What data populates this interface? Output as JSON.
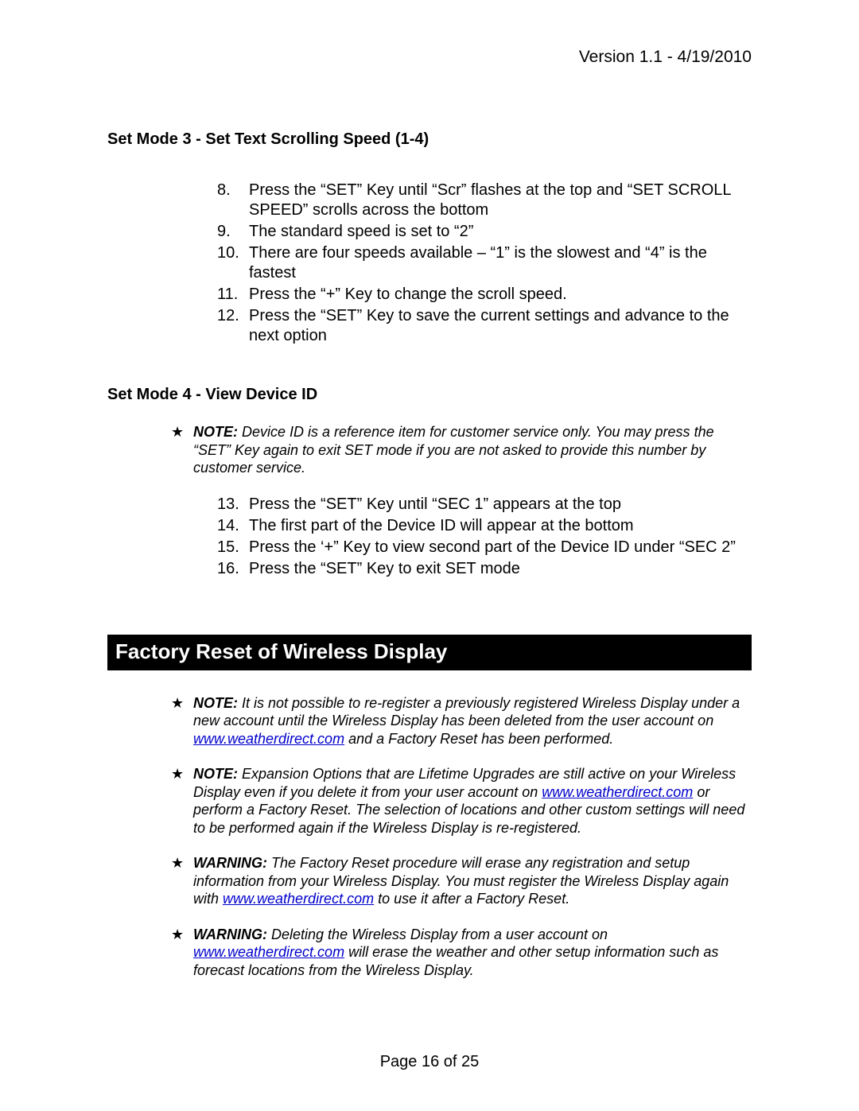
{
  "header_version": "Version 1.1 - 4/19/2010",
  "set_mode_3": {
    "heading": "Set Mode 3 - Set Text Scrolling Speed (1-4)",
    "items": [
      {
        "n": "8.",
        "text": "Press the “SET” Key until “Scr” flashes at the top and “SET SCROLL SPEED” scrolls across the bottom"
      },
      {
        "n": "9.",
        "text": "The standard speed is set to “2”"
      },
      {
        "n": "10.",
        "text": "There are four speeds available – “1” is the slowest and “4” is the fastest"
      },
      {
        "n": "11.",
        "text": "Press the “+” Key to change the scroll speed."
      },
      {
        "n": "12.",
        "text": "Press the “SET” Key to save the current settings and advance to the next option"
      }
    ]
  },
  "set_mode_4": {
    "heading": "Set Mode 4 - View Device ID",
    "note_label": "NOTE:",
    "note_text": "Device ID is a reference item for customer service only.  You may press the “SET” Key again to exit SET mode if you are not asked to provide this number by customer service.",
    "items": [
      {
        "n": "13.",
        "text": "Press the “SET” Key until “SEC 1” appears at the top"
      },
      {
        "n": "14.",
        "text": "The first part of the Device ID will appear at the bottom"
      },
      {
        "n": "15.",
        "text": "Press the ‘+” Key to view second part of the Device ID under “SEC 2”"
      },
      {
        "n": "16.",
        "text": "Press the “SET” Key to exit SET mode"
      }
    ]
  },
  "factory_reset": {
    "title": "Factory Reset of Wireless Display",
    "notes": [
      {
        "label": "NOTE:",
        "pre": "It is not possible to re-register a previously registered Wireless Display under a new account until the Wireless Display has been deleted from the user account on ",
        "link": "www.weatherdirect.com",
        "post": " and a Factory Reset has been performed."
      },
      {
        "label": "NOTE:",
        "pre": "Expansion Options that are Lifetime Upgrades are still active on your Wireless Display even if you delete it from your user account on ",
        "link": "www.weatherdirect.com",
        "post": " or perform a Factory Reset.  The selection of locations and other custom settings will need to be performed again if the Wireless Display is re-registered."
      },
      {
        "label": "WARNING:",
        "pre": "The Factory Reset procedure will erase any registration and setup information from your Wireless Display.  You must register the Wireless Display again with ",
        "link": "www.weatherdirect.com",
        "post": " to use it after a Factory Reset."
      },
      {
        "label": "WARNING:",
        "pre": "Deleting the Wireless Display from a user account on ",
        "link": "www.weatherdirect.com",
        "post": " will erase the weather and other setup information such as forecast locations from the Wireless Display."
      }
    ]
  },
  "footer": "Page 16 of 25"
}
